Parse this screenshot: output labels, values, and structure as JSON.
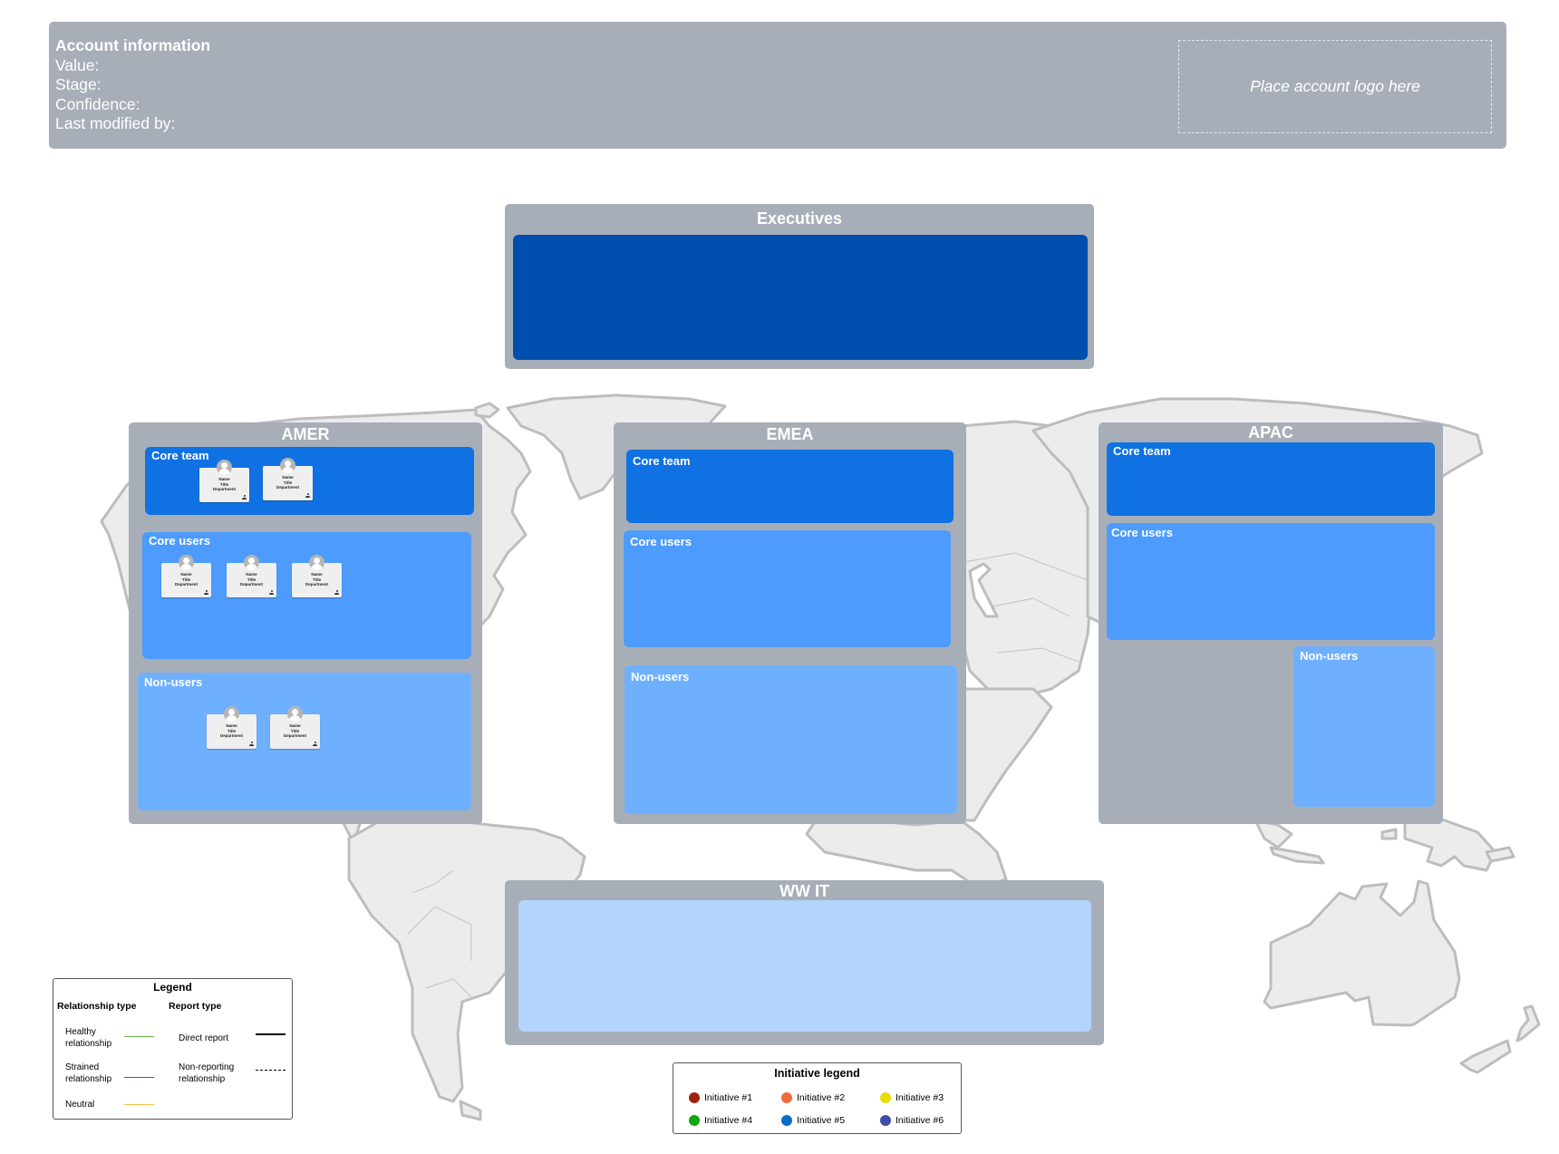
{
  "account": {
    "title": "Account information",
    "fields": [
      "Value:",
      "Stage:",
      "Confidence:",
      "Last modified by:"
    ],
    "logo_placeholder": "Place account logo here"
  },
  "colors": {
    "group_bg": "#a8aeb8",
    "executives": "#004fae",
    "core_team": "#1071e3",
    "core_users": "#4d9bfd",
    "non_users": "#6eb0fe",
    "ww_it": "#b3d4fc",
    "map_fill": "#ececec",
    "map_stroke": "#bdbdbd"
  },
  "executives": {
    "title": "Executives"
  },
  "regions": [
    {
      "title": "AMER",
      "core_team": {
        "label": "Core team",
        "cards": [
          {
            "name": "Name",
            "title": "Title",
            "department": "Department"
          },
          {
            "name": "Name",
            "title": "Title",
            "department": "Department"
          }
        ]
      },
      "core_users": {
        "label": "Core users",
        "cards": [
          {
            "name": "Name",
            "title": "Title",
            "department": "Department"
          },
          {
            "name": "Name",
            "title": "Title",
            "department": "Department"
          },
          {
            "name": "Name",
            "title": "Title",
            "department": "Department"
          }
        ]
      },
      "non_users": {
        "label": "Non-users",
        "cards": [
          {
            "name": "Name",
            "title": "Title",
            "department": "Department"
          },
          {
            "name": "Name",
            "title": "Title",
            "department": "Department"
          }
        ]
      }
    },
    {
      "title": "EMEA",
      "core_team": {
        "label": "Core team",
        "cards": []
      },
      "core_users": {
        "label": "Core users",
        "cards": []
      },
      "non_users": {
        "label": "Non-users",
        "cards": []
      }
    },
    {
      "title": "APAC",
      "core_team": {
        "label": "Core team",
        "cards": []
      },
      "core_users": {
        "label": "Core users",
        "cards": []
      },
      "non_users": {
        "label": "Non-users",
        "cards": []
      }
    }
  ],
  "ww_it": {
    "title": "WW IT"
  },
  "legend": {
    "title": "Legend",
    "relationship_header": "Relationship type",
    "report_header": "Report type",
    "relationships": [
      {
        "label": "Healthy relationship",
        "color": "#6ab04c"
      },
      {
        "label": "Strained relationship",
        "color": "#c0392b"
      },
      {
        "label": "Neutral",
        "color": "#f5c242"
      }
    ],
    "reports": [
      {
        "label": "Direct report",
        "style": "solid"
      },
      {
        "label": "Non-reporting relationship",
        "style": "dashed"
      }
    ]
  },
  "initiative_legend": {
    "title": "Initiative legend",
    "items": [
      {
        "label": "Initiative #1",
        "color": "#a3200b"
      },
      {
        "label": "Initiative #2",
        "color": "#ef6a3d"
      },
      {
        "label": "Initiative #3",
        "color": "#e8dc00"
      },
      {
        "label": "Initiative #4",
        "color": "#10a810"
      },
      {
        "label": "Initiative #5",
        "color": "#0a6cc9"
      },
      {
        "label": "Initiative #6",
        "color": "#3f4ca8"
      }
    ]
  }
}
